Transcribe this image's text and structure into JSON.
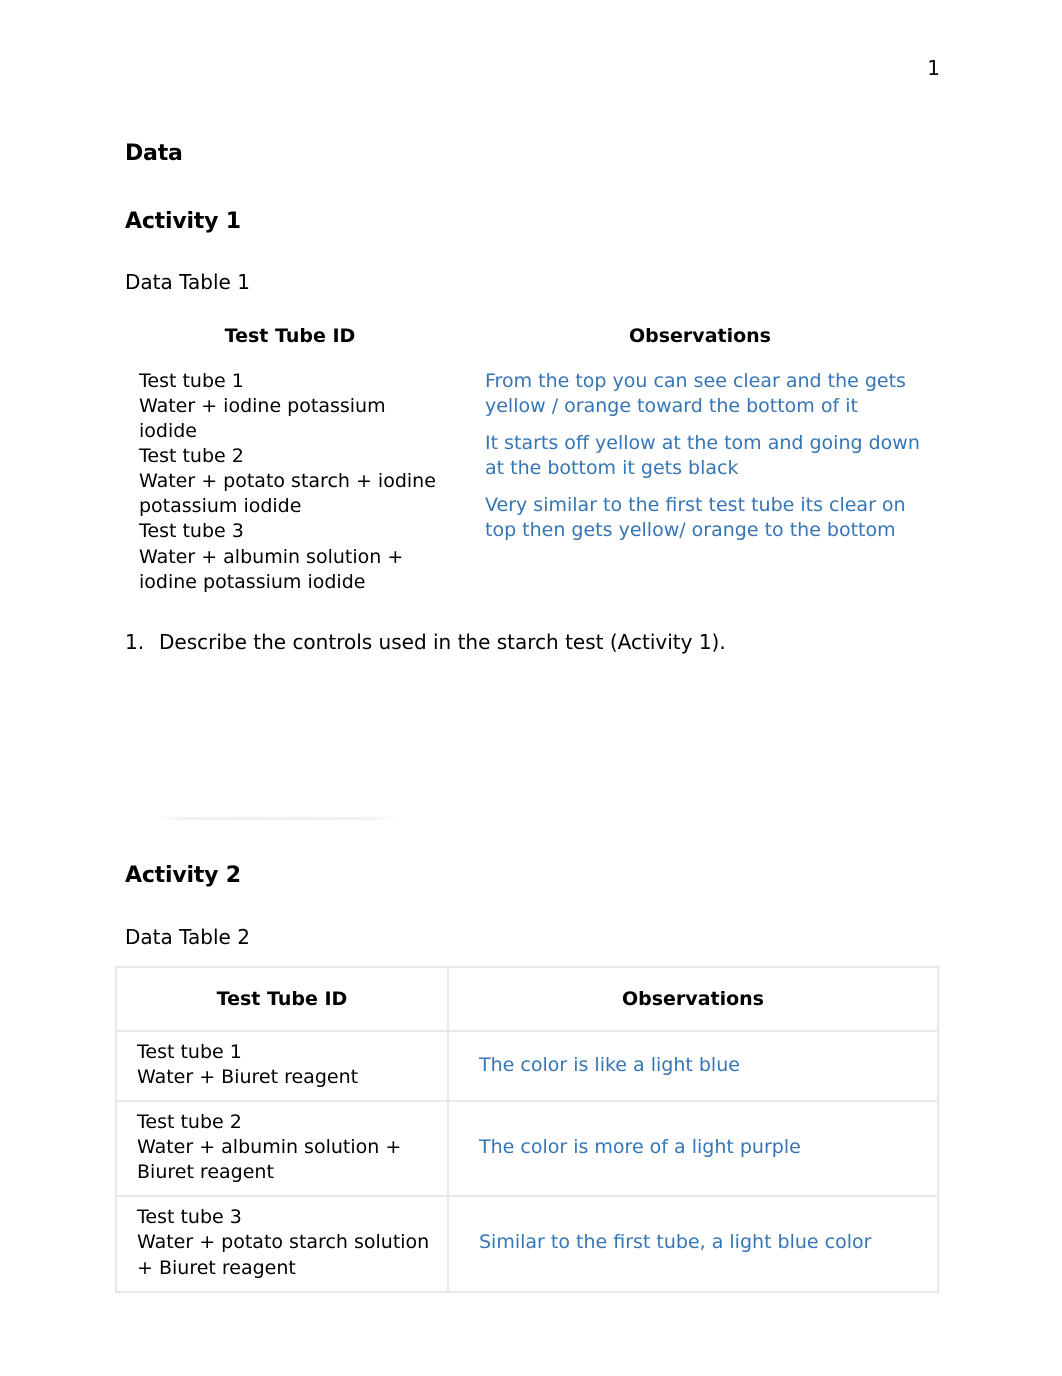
{
  "document": {
    "page_number": "1",
    "heading": "Data"
  },
  "activity1": {
    "heading": "Activity 1",
    "table_label": "Data Table 1",
    "table": {
      "headers": {
        "col1": "Test Tube ID",
        "col2": "Observations"
      },
      "rows": [
        {
          "id_line1": "Test tube 1",
          "id_line2": "Water + iodine potassium iodide",
          "observation": "From the top you can see clear and the gets yellow / orange toward the bottom of it"
        },
        {
          "id_line1": "Test tube 2",
          "id_line2": "Water + potato starch + iodine potassium iodide",
          "observation": "It starts off yellow at the tom and going down at the bottom it gets black"
        },
        {
          "id_line1": "Test tube 3",
          "id_line2": "Water + albumin solution + iodine potassium iodide",
          "observation": "Very similar to the first test tube its clear on top then gets yellow/ orange to the bottom"
        }
      ]
    },
    "question": {
      "number": "1.",
      "text": "Describe the controls used in the starch test (Activity 1)."
    }
  },
  "activity2": {
    "heading": "Activity 2",
    "table_label": "Data Table 2",
    "table": {
      "headers": {
        "col1": "Test Tube ID",
        "col2": "Observations"
      },
      "rows": [
        {
          "id_line1": "Test tube 1",
          "id_line2": "Water + Biuret reagent",
          "observation": "The color is like a light blue"
        },
        {
          "id_line1": "Test tube 2",
          "id_line2": "Water + albumin solution + Biuret reagent",
          "observation": "The color is more of a light purple"
        },
        {
          "id_line1": "Test tube 3",
          "id_line2": "Water + potato starch solution + Biuret reagent",
          "observation": "Similar to the first tube, a light blue color"
        }
      ]
    }
  },
  "colors": {
    "observation_text": "#3575b5",
    "table_border": "#e8e8e8",
    "body_text": "#000000"
  }
}
